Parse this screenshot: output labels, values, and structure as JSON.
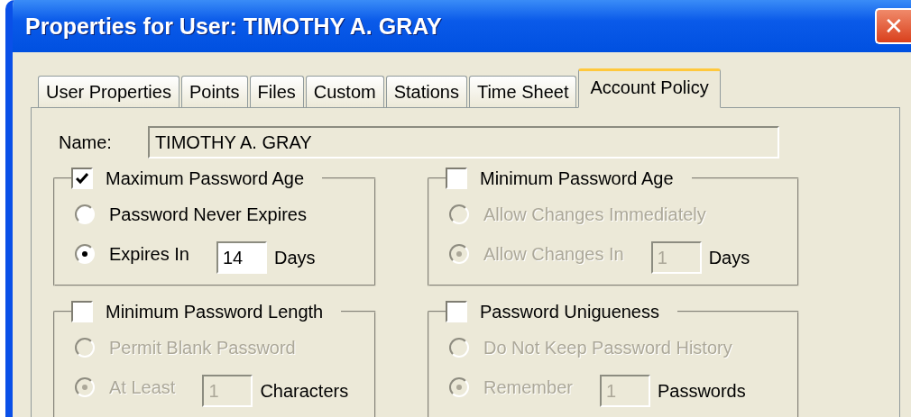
{
  "window": {
    "title": "Properties for User: TIMOTHY A. GRAY",
    "close": "✕"
  },
  "tabs": [
    {
      "label": "User Properties",
      "selected": false
    },
    {
      "label": "Points",
      "selected": false
    },
    {
      "label": "Files",
      "selected": false
    },
    {
      "label": "Custom",
      "selected": false
    },
    {
      "label": "Stations",
      "selected": false
    },
    {
      "label": "Time Sheet",
      "selected": false
    },
    {
      "label": "Account Policy",
      "selected": true
    }
  ],
  "name": {
    "label": "Name:",
    "value": "TIMOTHY A. GRAY"
  },
  "groups": [
    {
      "title": "Maximum Password Age",
      "checked": true,
      "options": [
        {
          "label": "Password Never Expires",
          "selected": false,
          "disabled": false
        },
        {
          "label": "Expires In",
          "selected": true,
          "disabled": false,
          "value": "14",
          "unit": "Days"
        }
      ]
    },
    {
      "title": "Minimum Password Age",
      "checked": false,
      "options": [
        {
          "label": "Allow Changes Immediately",
          "selected": false,
          "disabled": true
        },
        {
          "label": "Allow Changes In",
          "selected": true,
          "disabled": true,
          "value": "1",
          "unit": "Days"
        }
      ]
    },
    {
      "title": "Minimum Password Length",
      "checked": false,
      "options": [
        {
          "label": "Permit Blank Password",
          "selected": false,
          "disabled": true
        },
        {
          "label": "At Least",
          "selected": true,
          "disabled": true,
          "value": "1",
          "unit": "Characters"
        }
      ]
    },
    {
      "title": "Password Unigueness",
      "checked": false,
      "options": [
        {
          "label": "Do Not Keep Password History",
          "selected": false,
          "disabled": true
        },
        {
          "label": "Remember",
          "selected": true,
          "disabled": true,
          "value": "1",
          "unit": "Passwords"
        }
      ]
    }
  ]
}
